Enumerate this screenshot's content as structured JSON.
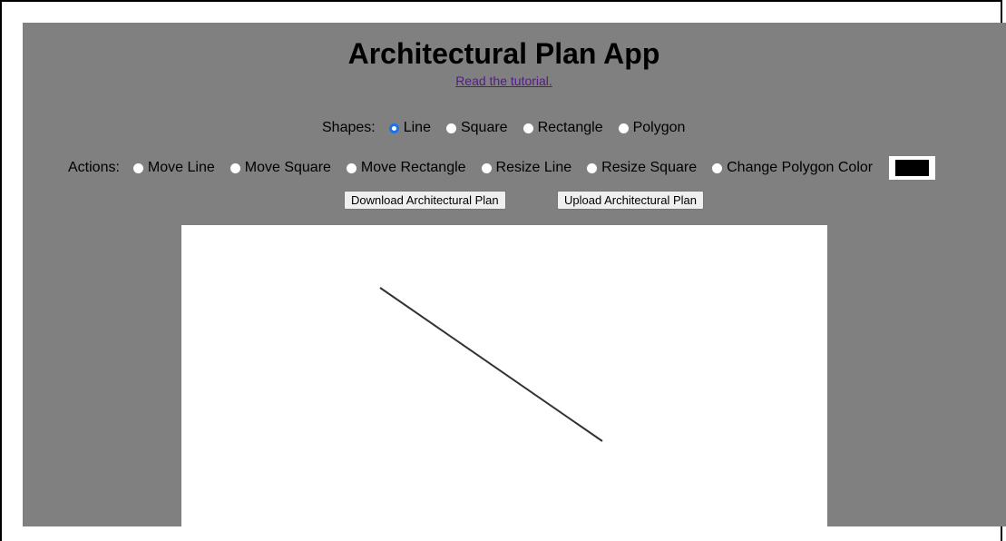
{
  "app": {
    "title": "Architectural Plan App",
    "tutorial_link": "Read the tutorial."
  },
  "shapes": {
    "label": "Shapes:",
    "options": [
      {
        "label": "Line",
        "checked": true
      },
      {
        "label": "Square",
        "checked": false
      },
      {
        "label": "Rectangle",
        "checked": false
      },
      {
        "label": "Polygon",
        "checked": false
      }
    ]
  },
  "actions": {
    "label": "Actions:",
    "options": [
      {
        "label": "Move Line",
        "checked": false
      },
      {
        "label": "Move Square",
        "checked": false
      },
      {
        "label": "Move Rectangle",
        "checked": false
      },
      {
        "label": "Resize Line",
        "checked": false
      },
      {
        "label": "Resize Square",
        "checked": false
      },
      {
        "label": "Change Polygon Color",
        "checked": false
      }
    ],
    "polygon_color": "#000000"
  },
  "buttons": {
    "download": "Download Architectural Plan",
    "upload": "Upload Architectural Plan"
  },
  "colors": {
    "app_background": "#808080",
    "canvas_background": "#ffffff",
    "drawn_line": "#333333"
  }
}
